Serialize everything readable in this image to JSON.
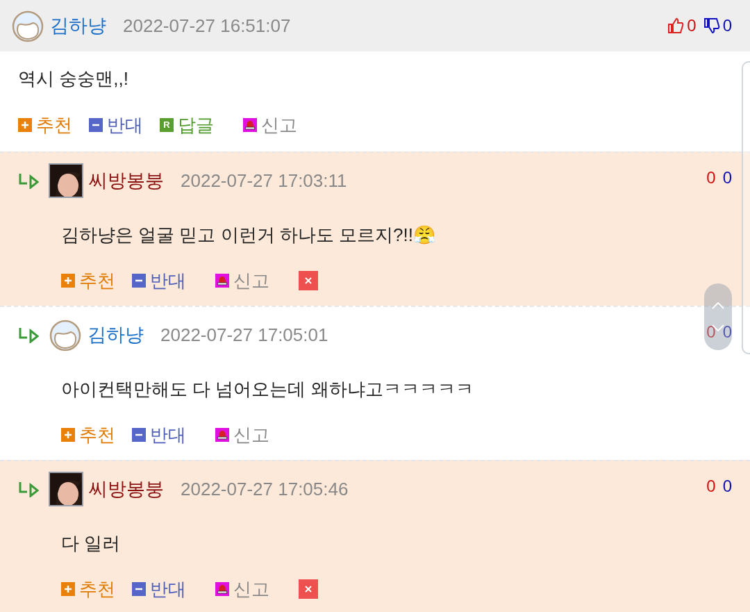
{
  "comments": [
    {
      "kind": "comment",
      "highlighted": false,
      "photo_avatar": false,
      "author": "김하냥",
      "color": "#1a6fc9",
      "date": "2022-07-27 16:51:07",
      "thumbs": true,
      "likes": "0",
      "dislikes": "0",
      "text": "역시 숭숭맨,,!",
      "actions": [
        {
          "kind": "recommend",
          "label": "추천"
        },
        {
          "kind": "oppose",
          "label": "반대"
        },
        {
          "kind": "reply",
          "badge": "R",
          "label": "답글"
        },
        {
          "kind": "report",
          "label": "신고"
        }
      ]
    },
    {
      "kind": "reply",
      "highlighted": true,
      "photo_avatar": true,
      "author": "씨방봉붕",
      "color": "#8b1010",
      "date": "2022-07-27 17:03:11",
      "thumbs": false,
      "likes": "0",
      "dislikes": "0",
      "text": "김하냥은 얼굴 믿고 이런거 하나도 모르지?!!😤",
      "actions": [
        {
          "kind": "recommend",
          "label": "추천"
        },
        {
          "kind": "oppose",
          "label": "반대"
        },
        {
          "kind": "report",
          "label": "신고"
        },
        {
          "kind": "delete"
        }
      ]
    },
    {
      "kind": "reply",
      "highlighted": false,
      "photo_avatar": false,
      "author": "김하냥",
      "color": "#1a6fc9",
      "date": "2022-07-27 17:05:01",
      "thumbs": false,
      "likes": "0",
      "dislikes": "0",
      "text": "아이컨택만해도 다 넘어오는데 왜하냐고ㅋㅋㅋㅋㅋ",
      "actions": [
        {
          "kind": "recommend",
          "label": "추천"
        },
        {
          "kind": "oppose",
          "label": "반대"
        },
        {
          "kind": "report",
          "label": "신고"
        }
      ]
    },
    {
      "kind": "reply",
      "highlighted": true,
      "photo_avatar": true,
      "author": "씨방봉붕",
      "color": "#8b1010",
      "date": "2022-07-27 17:05:46",
      "thumbs": false,
      "likes": "0",
      "dislikes": "0",
      "text": "다 일러",
      "actions": [
        {
          "kind": "recommend",
          "label": "추천"
        },
        {
          "kind": "oppose",
          "label": "반대"
        },
        {
          "kind": "report",
          "label": "신고"
        },
        {
          "kind": "delete"
        }
      ]
    }
  ]
}
